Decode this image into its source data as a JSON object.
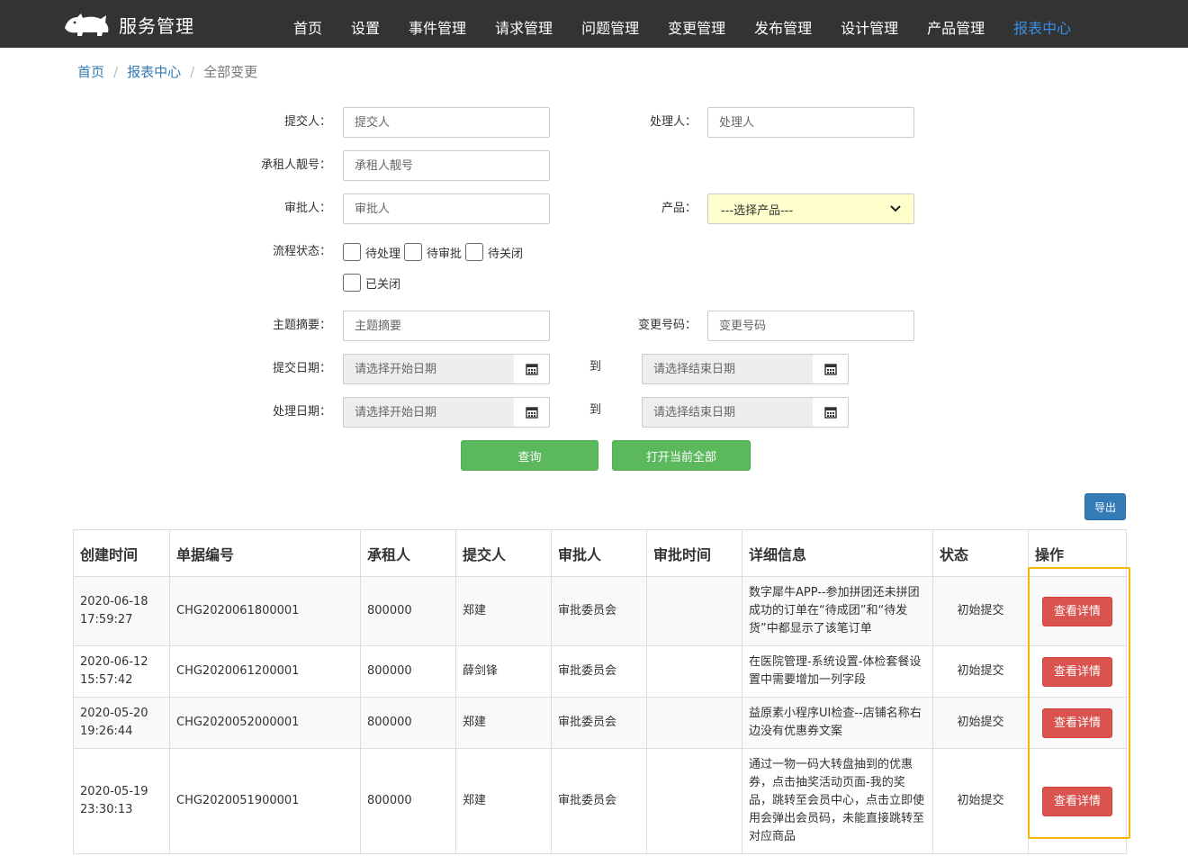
{
  "brand": {
    "title": "服务管理",
    "logo_icon": "rhino-icon"
  },
  "nav": {
    "items": [
      "首页",
      "设置",
      "事件管理",
      "请求管理",
      "问题管理",
      "变更管理",
      "发布管理",
      "设计管理",
      "产品管理",
      "报表中心"
    ],
    "active": "报表中心",
    "active_color": "#3b8ee6"
  },
  "breadcrumb": {
    "home": "首页",
    "section": "报表中心",
    "current": "全部变更",
    "separator": "/"
  },
  "form": {
    "submitter": {
      "label": "提交人：",
      "placeholder": "提交人"
    },
    "handler": {
      "label": "处理人：",
      "placeholder": "处理人"
    },
    "tenant": {
      "label": "承租人靓号：",
      "placeholder": "承租人靓号"
    },
    "approver": {
      "label": "审批人：",
      "placeholder": "审批人"
    },
    "product": {
      "label": "产品：",
      "selected": "---选择产品---"
    },
    "status": {
      "label": "流程状态：",
      "options": [
        "待处理",
        "待审批",
        "待关闭",
        "已关闭"
      ]
    },
    "summary": {
      "label": "主题摘要：",
      "placeholder": "主题摘要"
    },
    "change_no": {
      "label": "变更号码：",
      "placeholder": "变更号码"
    },
    "submit_date": {
      "label": "提交日期：",
      "start_placeholder": "请选择开始日期",
      "to": "到",
      "end_placeholder": "请选择结束日期"
    },
    "handle_date": {
      "label": "处理日期：",
      "start_placeholder": "请选择开始日期",
      "to": "到",
      "end_placeholder": "请选择结束日期"
    },
    "query_button": "查询",
    "open_all_button": "打开当前全部"
  },
  "export_button": "导出",
  "table": {
    "headers": [
      "创建时间",
      "单据编号",
      "承租人",
      "提交人",
      "审批人",
      "审批时间",
      "详细信息",
      "状态",
      "操作"
    ],
    "rows": [
      {
        "date": "2020-06-18",
        "time": "17:59:27",
        "id": "CHG2020061800001",
        "tenant": "800000",
        "submitter": "郑建",
        "approver": "审批委员会",
        "approve_time": "",
        "detail": "数字犀牛APP--参加拼团还未拼团成功的订单在“待成团”和“待发货”中都显示了该笔订单",
        "status": "初始提交",
        "action": "查看详情"
      },
      {
        "date": "2020-06-12",
        "time": "15:57:42",
        "id": "CHG2020061200001",
        "tenant": "800000",
        "submitter": "薛剑锋",
        "approver": "审批委员会",
        "approve_time": "",
        "detail": "在医院管理-系统设置-体检套餐设置中需要增加一列字段",
        "status": "初始提交",
        "action": "查看详情"
      },
      {
        "date": "2020-05-20",
        "time": "19:26:44",
        "id": "CHG2020052000001",
        "tenant": "800000",
        "submitter": "郑建",
        "approver": "审批委员会",
        "approve_time": "",
        "detail": "益原素小程序UI检查--店铺名称右边没有优惠券文案",
        "status": "初始提交",
        "action": "查看详情"
      },
      {
        "date": "2020-05-19",
        "time": "23:30:13",
        "id": "CHG2020051900001",
        "tenant": "800000",
        "submitter": "郑建",
        "approver": "审批委员会",
        "approve_time": "",
        "detail": "通过一物一码大转盘抽到的优惠券，点击抽奖活动页面-我的奖品，跳转至会员中心，点击立即使用会弹出会员码，未能直接跳转至对应商品",
        "status": "初始提交",
        "action": "查看详情"
      }
    ]
  },
  "colors": {
    "navbar": "#333333",
    "green": "#5cb85c",
    "blue": "#337ab7",
    "red": "#d9534f",
    "highlight": "#f5b800",
    "select_bg": "#ffffcc"
  }
}
